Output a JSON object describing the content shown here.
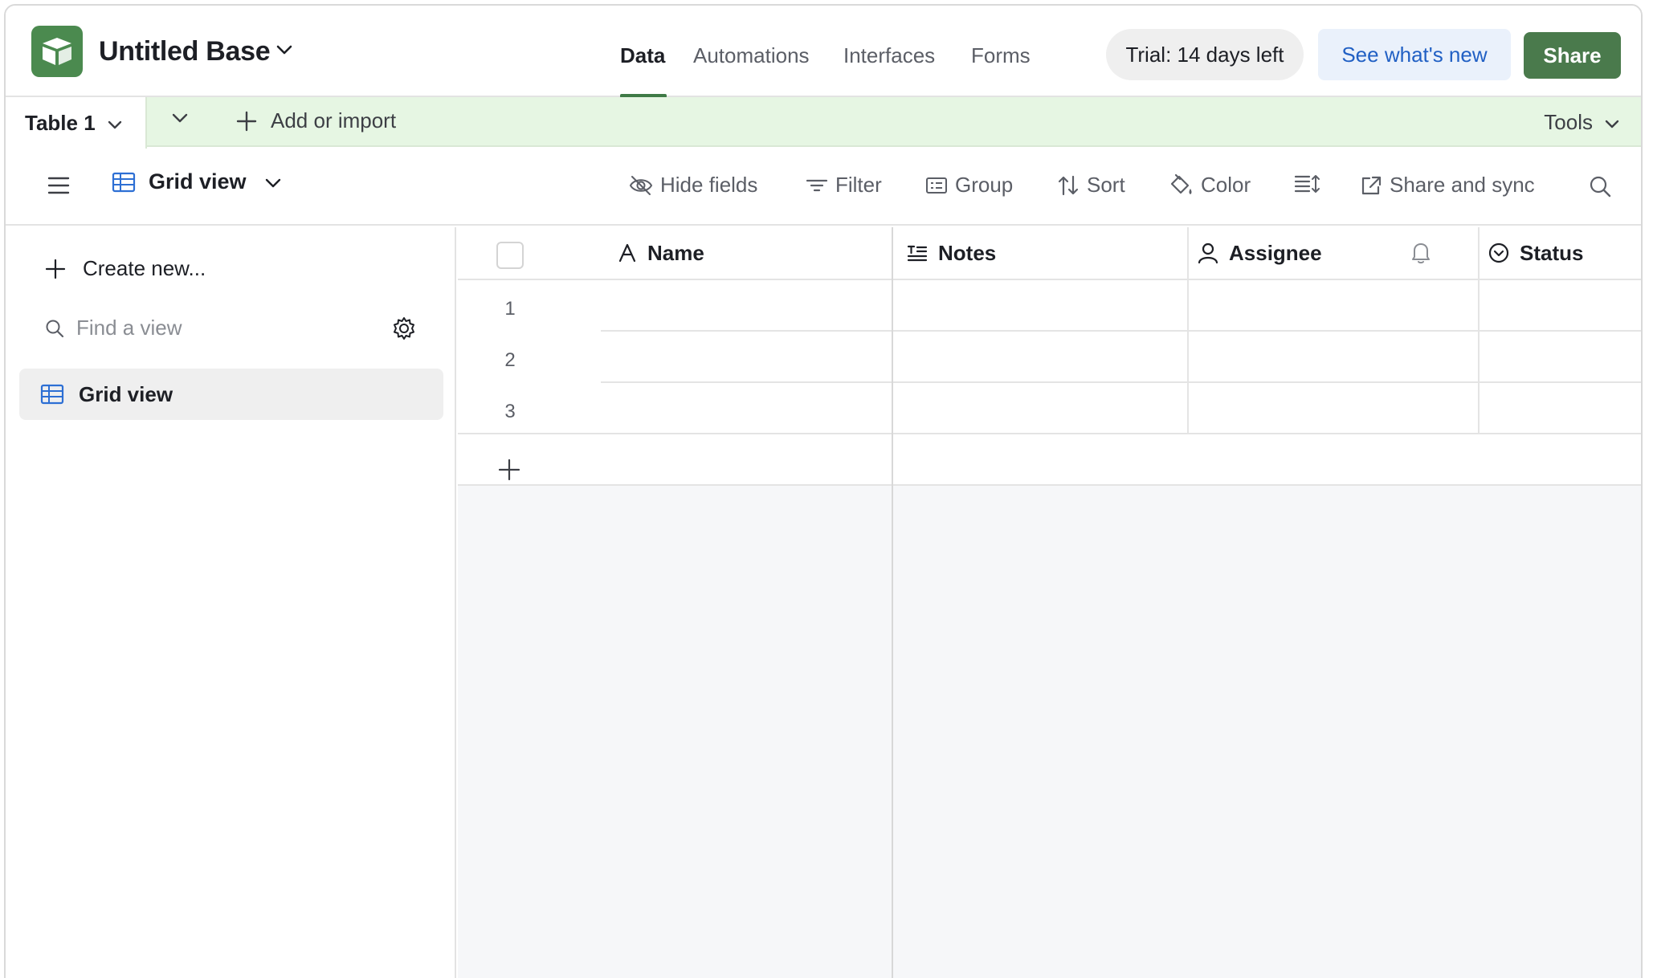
{
  "header": {
    "base_title": "Untitled Base",
    "nav": [
      {
        "label": "Data",
        "active": true
      },
      {
        "label": "Automations",
        "active": false
      },
      {
        "label": "Interfaces",
        "active": false
      },
      {
        "label": "Forms",
        "active": false
      }
    ],
    "trial_label": "Trial: 14 days left",
    "whats_new_label": "See what's new",
    "share_label": "Share"
  },
  "tables": {
    "active_tab": "Table 1",
    "add_import_label": "Add or import",
    "tools_label": "Tools"
  },
  "viewbar": {
    "view_name": "Grid view",
    "tools": [
      "Hide fields",
      "Filter",
      "Group",
      "Sort",
      "Color",
      "Share and sync"
    ]
  },
  "sidebar": {
    "create_new_label": "Create new...",
    "find_view_placeholder": "Find a view",
    "views": [
      "Grid view"
    ]
  },
  "grid": {
    "columns": [
      "Name",
      "Notes",
      "Assignee",
      "Status"
    ],
    "rows": [
      "1",
      "2",
      "3"
    ]
  },
  "colors": {
    "brand_green": "#4a7a4c",
    "table_bar_bg": "#e6f6e3",
    "link_blue": "#2160c4",
    "view_icon_blue": "#2d6fd4"
  }
}
